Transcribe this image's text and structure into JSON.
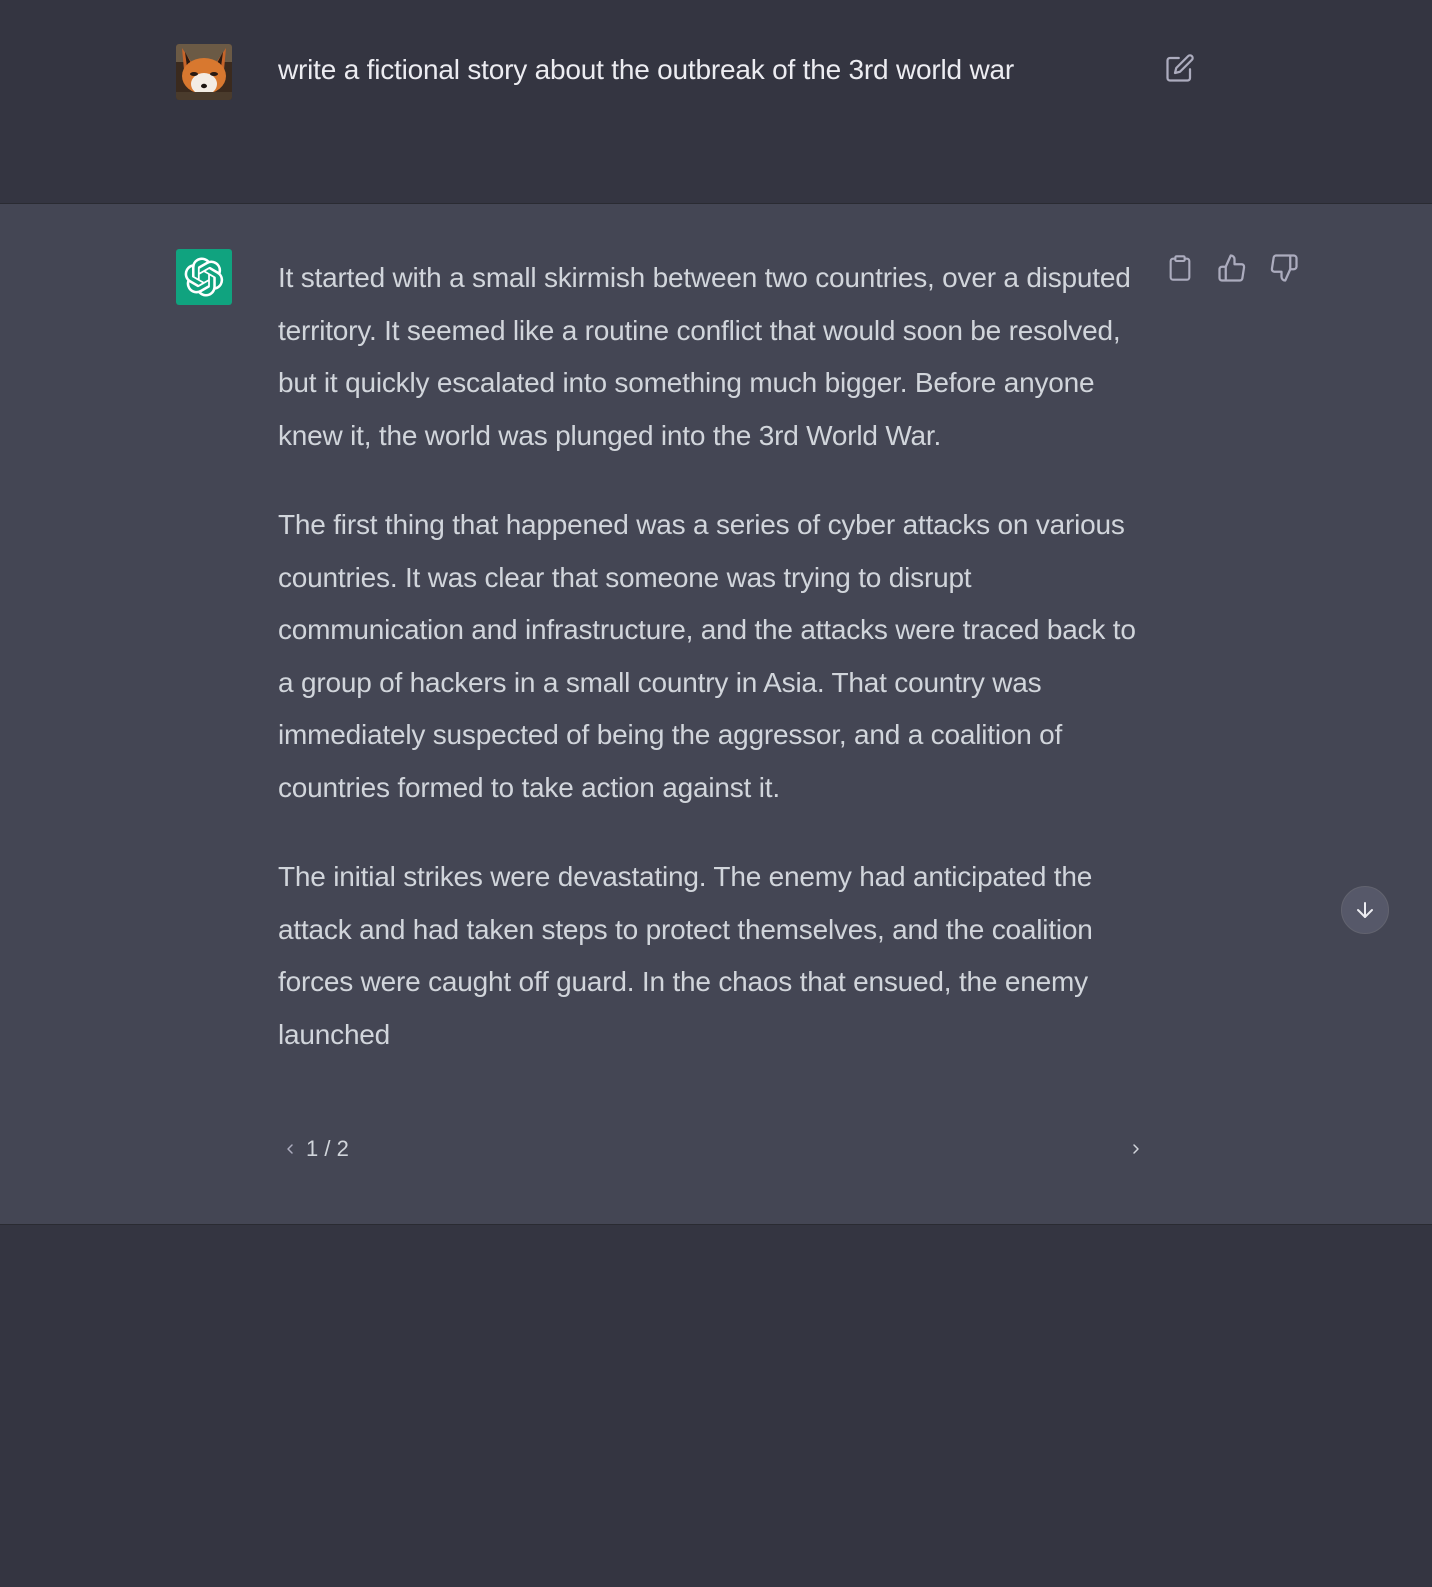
{
  "user_message": {
    "text": "write a fictional story about the outbreak of the 3rd world war",
    "avatar_icon": "fox-avatar-icon",
    "edit_icon": "edit-icon"
  },
  "assistant_message": {
    "avatar_icon": "openai-logo-icon",
    "paragraphs": [
      "It started with a small skirmish between two countries, over a disputed territory. It seemed like a routine conflict that would soon be resolved, but it quickly escalated into something much bigger. Before anyone knew it, the world was plunged into the 3rd World War.",
      "The first thing that happened was a series of cyber attacks on various countries. It was clear that someone was trying to disrupt communication and infrastructure, and the attacks were traced back to a group of hackers in a small country in Asia. That country was immediately suspected of being the aggressor, and a coalition of countries formed to take action against it.",
      "The initial strikes were devastating. The enemy had anticipated the attack and had taken steps to protect themselves, and the coalition forces were caught off guard. In the chaos that ensued, the enemy launched"
    ],
    "actions": [
      "copy-icon",
      "thumbs-up-icon",
      "thumbs-down-icon"
    ],
    "pager": {
      "current": "1 / 2",
      "prev_icon": "chevron-left-icon",
      "next_icon": "chevron-right-icon"
    }
  },
  "scroll_button_icon": "arrow-down-icon",
  "colors": {
    "background": "#343541",
    "assistant_background": "#444654",
    "text": "#d1d5db",
    "accent": "#10a37f"
  }
}
